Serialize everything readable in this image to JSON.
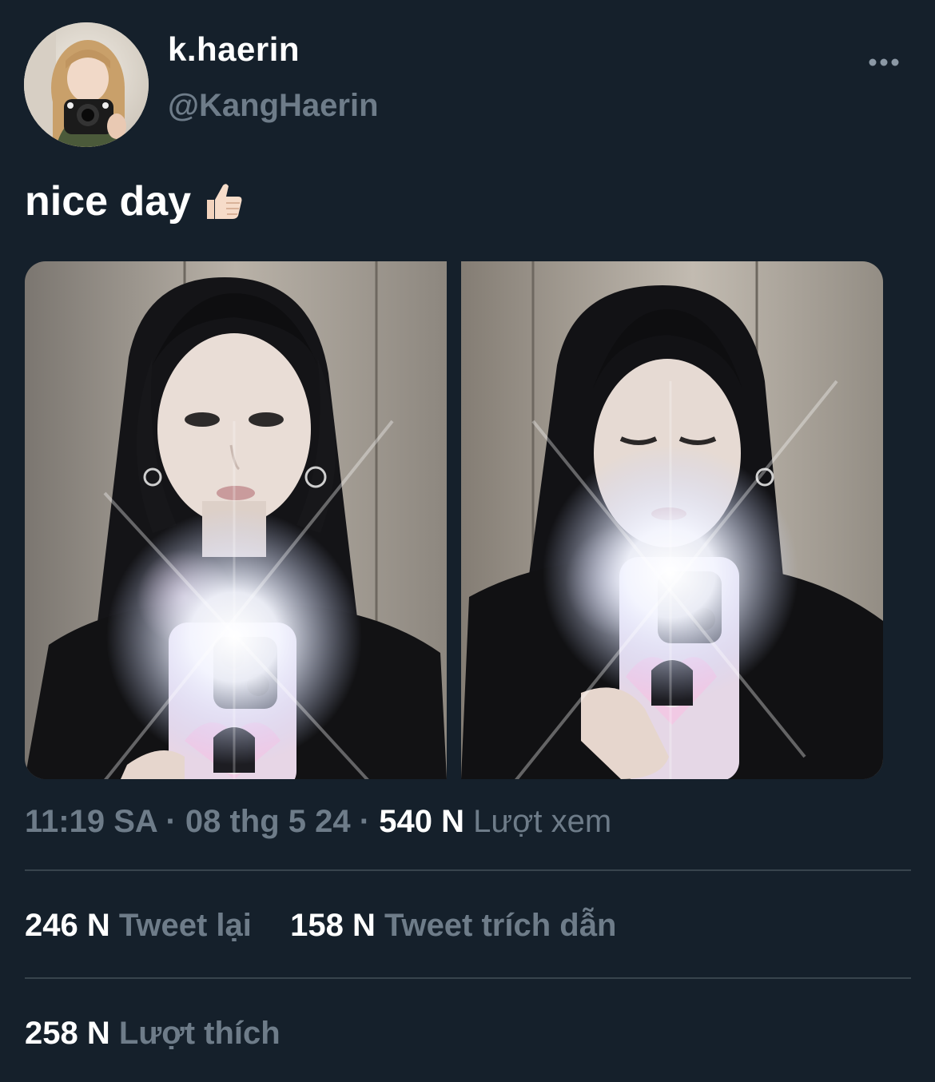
{
  "author": {
    "display_name": "k.haerin",
    "handle": "@KangHaerin"
  },
  "tweet": {
    "text": "nice day",
    "emoji": "thumbs-up-icon"
  },
  "media": [
    {
      "kind": "mirror-selfie-photo",
      "name": "photo-1"
    },
    {
      "kind": "mirror-selfie-photo",
      "name": "photo-2"
    }
  ],
  "meta": {
    "time": "11:19 SA",
    "separator": "·",
    "date": "08 thg 5 24",
    "views_count": "540 N",
    "views_label": "Lượt xem"
  },
  "stats": {
    "retweets_count": "246 N",
    "retweets_label": "Tweet lại",
    "quotes_count": "158 N",
    "quotes_label": "Tweet trích dẫn",
    "likes_count": "258 N",
    "likes_label": "Lượt thích"
  },
  "colors": {
    "background": "#15202b",
    "primary_text": "#ffffff",
    "secondary_text": "#6e7c89",
    "divider": "#38444d"
  }
}
